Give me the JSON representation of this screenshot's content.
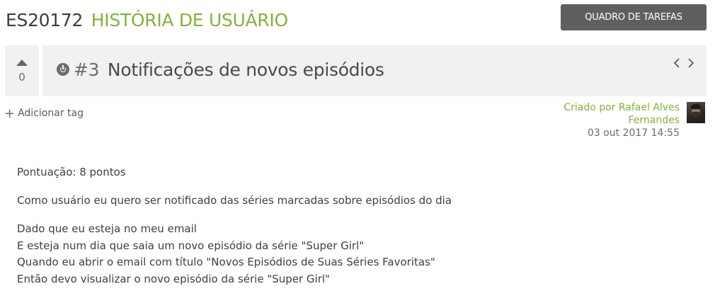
{
  "header": {
    "project_ref": "ES20172",
    "item_kind": "HISTÓRIA DE USUÁRIO",
    "taskboard_label": "QUADRO DE TAREFAS"
  },
  "story": {
    "votes": "0",
    "number": "#3",
    "subject": "Notificações de novos episódios"
  },
  "tags": {
    "add_label": "Adicionar tag"
  },
  "creator": {
    "line1": "Criado por Rafael Alves",
    "line2": "Fernandes",
    "date": "03 out 2017 14:55"
  },
  "description": {
    "points": "Pontuação: 8 pontos",
    "summary": "Como usuário eu quero ser notificado das séries marcadas sobre episódios do dia",
    "scenario": [
      "Dado que eu esteja no meu email",
      "E esteja num dia que saia um novo episódio da série \"Super Girl\"",
      "Quando eu abrir o email com título \"Novos Episódios de Suas Séries Favoritas\"",
      "Então devo visualizar o novo episódio da série \"Super Girl\""
    ]
  },
  "colors": {
    "accent_green": "#83b23b",
    "button_bg": "#5f5f5f",
    "panel_bg": "#f1f1f1"
  },
  "icons": [
    "upvote-icon",
    "status-icon",
    "chevron-left-icon",
    "chevron-right-icon",
    "plus-icon",
    "avatar"
  ]
}
